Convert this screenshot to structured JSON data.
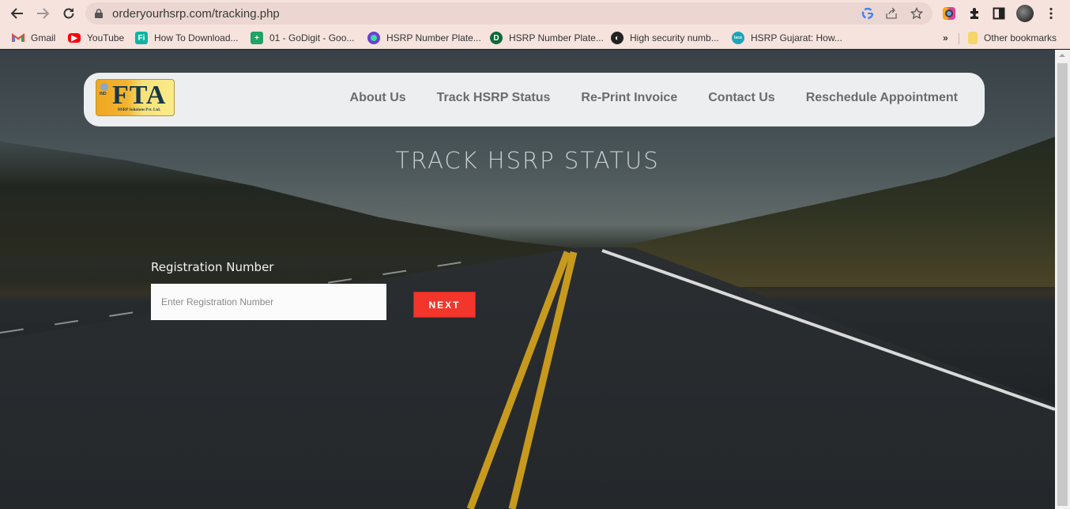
{
  "browser": {
    "url": "orderyourhsrp.com/tracking.php",
    "icons": {
      "back": "back-arrow-icon",
      "forward": "forward-arrow-icon",
      "reload": "reload-icon",
      "lock": "lock-icon",
      "google": "google-icon",
      "share": "share-icon",
      "star": "bookmark-star-icon",
      "extension1": "color-extension-icon",
      "extensions": "puzzle-icon",
      "sidepanel": "side-panel-icon",
      "profile": "profile-avatar",
      "menu": "kebab-menu-icon"
    },
    "bookmarks": [
      {
        "label": "Gmail",
        "icon": "gmail-icon",
        "color": "#ea4335"
      },
      {
        "label": "YouTube",
        "icon": "youtube-icon",
        "color": "#ff0000"
      },
      {
        "label": "How To Download...",
        "icon": "fi-icon",
        "color": "#10b3a3"
      },
      {
        "label": "01 - GoDigit - Goo...",
        "icon": "sheets-icon",
        "color": "#1fa463"
      },
      {
        "label": "HSRP Number Plate...",
        "icon": "circle-icon",
        "color": "#6b3fd4"
      },
      {
        "label": "HSRP Number Plate...",
        "icon": "d-icon",
        "color": "#0e6b3a"
      },
      {
        "label": "High security numb...",
        "icon": "globe-icon",
        "color": "#222222"
      },
      {
        "label": "HSRP Gujarat: How...",
        "icon": "teal-icon",
        "color": "#1aa6b7"
      }
    ],
    "overflow": "»",
    "other_bookmarks": "Other bookmarks"
  },
  "site": {
    "logo": {
      "main": "FTA",
      "sub": "HSRP Solutions Pvt. Ltd.",
      "emblem": "IND"
    },
    "nav": [
      {
        "label": "About Us"
      },
      {
        "label": "Track HSRP Status"
      },
      {
        "label": "Re-Print Invoice"
      },
      {
        "label": "Contact Us"
      },
      {
        "label": "Reschedule Appointment"
      }
    ],
    "title": "TRACK HSRP STATUS",
    "form": {
      "label": "Registration Number",
      "value": "",
      "placeholder": "Enter Registration Number",
      "button": "NEXT"
    },
    "colors": {
      "accent": "#f2362b",
      "navbar": "#eceeef",
      "nav_text": "#6b6b6b"
    }
  }
}
